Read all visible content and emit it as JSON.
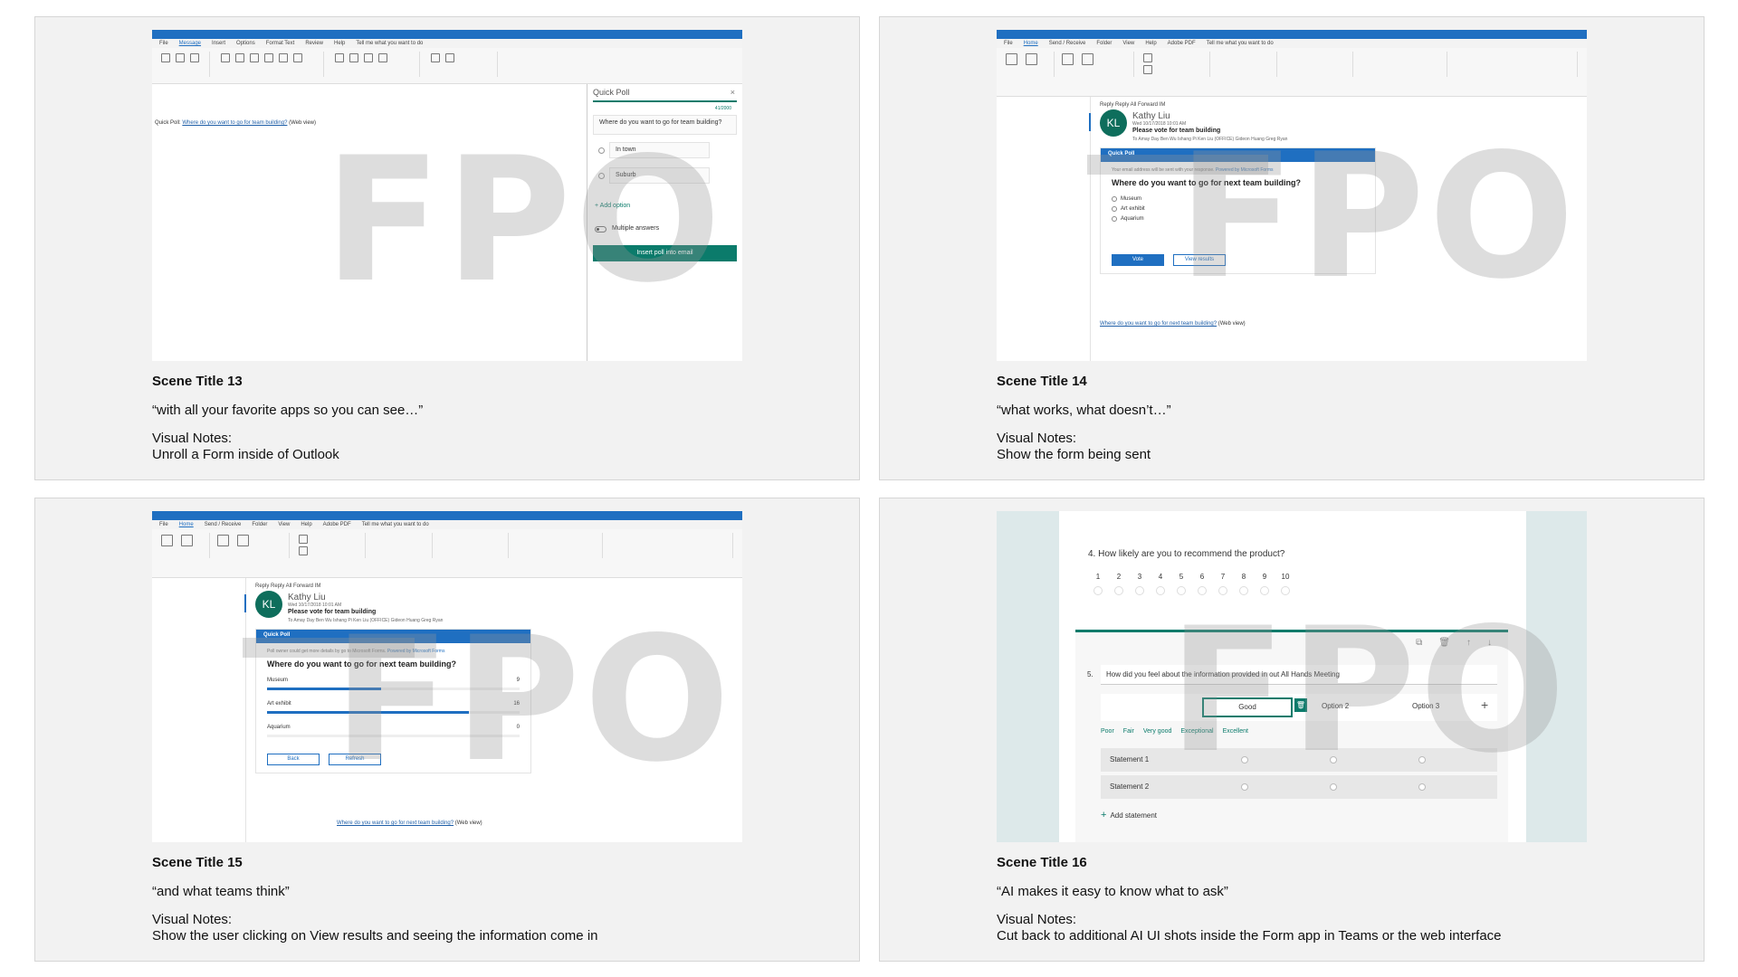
{
  "scenes": [
    {
      "title": "Scene Title 13",
      "quote": "“with all your favorite apps so you can see…”",
      "notes_label": "Visual Notes:",
      "notes": "Unroll a Form inside of Outlook",
      "mock": {
        "watermark": "FPO",
        "ribbon_tabs": [
          "File",
          "Message",
          "Insert",
          "Options",
          "Format Text",
          "Review",
          "Help",
          "Tell me what you want to do"
        ],
        "compose_link_prefix": "Quick Poll:",
        "compose_link": "Where do you want to go for team building?",
        "compose_link_suffix": "(Web view)",
        "pane_title": "Quick Poll",
        "pane_close": "×",
        "pane_count": "41/2000",
        "question": "Where do you want to go for team building?",
        "options": [
          "In town",
          "Suburb"
        ],
        "add_option": "+ Add option",
        "multiple_answers": "Multiple answers",
        "insert_button": "Insert poll into email"
      }
    },
    {
      "title": "Scene Title 14",
      "quote": "“what works, what doesn’t…”",
      "notes_label": "Visual Notes:",
      "notes": "Show the form being sent",
      "mock": {
        "watermark": "FPO",
        "ribbon_tabs": [
          "File",
          "Home",
          "Send / Receive",
          "Folder",
          "View",
          "Help",
          "Adobe PDF",
          "Tell me what you want to do"
        ],
        "actions": "Reply   Reply All   Forward   IM",
        "avatar": "KL",
        "sender": "Kathy Liu",
        "date": "Wed 10/17/2018 10:01 AM",
        "subject": "Please vote for team building",
        "recipients": "To  Amay Day  Ben Wu  Ishang Pi  Ken Liu (OFFICE)  Gideon Huang  Greg Ryan",
        "band": "Quick Poll",
        "note": "Your email address will be sent with your response.",
        "powered": "Powered by Microsoft Forms",
        "question": "Where do you want to go for next team building?",
        "options": [
          "Museum",
          "Art exhibit",
          "Aquarium"
        ],
        "vote_button": "Vote",
        "results_button": "View results",
        "footer_link": "Where do you want to go for next team building?",
        "footer_suffix": "(Web view)"
      }
    },
    {
      "title": "Scene Title 15",
      "quote": "“and what teams think”",
      "notes_label": "Visual Notes:",
      "notes": "Show the user clicking on View results and seeing the information come in",
      "mock": {
        "watermark": "FPO",
        "ribbon_tabs": [
          "File",
          "Home",
          "Send / Receive",
          "Folder",
          "View",
          "Help",
          "Adobe PDF",
          "Tell me what you want to do"
        ],
        "actions": "Reply   Reply All   Forward   IM",
        "avatar": "KL",
        "sender": "Kathy Liu",
        "date": "Wed 10/17/2018 10:01 AM",
        "subject": "Please vote for team building",
        "recipients": "To  Amay Day  Ben Wu  Ishang Pi  Ken Liu (OFFICE)  Gideon Huang  Greg Ryan",
        "band": "Quick Poll",
        "note": "Poll owner could get more details by go to Microsoft Forms.",
        "powered": "Powered by Microsoft Forms",
        "question": "Where do you want to go for next team building?",
        "results": [
          {
            "label": "Museum",
            "count": 9
          },
          {
            "label": "Art exhibit",
            "count": 16
          },
          {
            "label": "Aquarium",
            "count": 0
          }
        ],
        "result_max": 20,
        "back_button": "Back",
        "refresh_button": "Refresh",
        "footer_link": "Where do you want to go for next team building?",
        "footer_suffix": "(Web view)"
      }
    },
    {
      "title": "Scene Title 16",
      "quote": "“AI makes it easy to know what to ask”",
      "notes_label": "Visual Notes:",
      "notes": "Cut back to additional AI UI shots inside the Form app in Teams or the web interface",
      "mock": {
        "watermark": "FPO",
        "q4": "4. How likely are you to recommend the product?",
        "scale": [
          "1",
          "2",
          "3",
          "4",
          "5",
          "6",
          "7",
          "8",
          "9",
          "10"
        ],
        "q5_num": "5.",
        "q5": "How did you feel about the information provided in out All Hands Meeting",
        "option_good": "Good",
        "option2": "Option 2",
        "option3": "Option 3",
        "add_icon": "+",
        "suggestions": [
          "Poor",
          "Fair",
          "Very good",
          "Exceptional",
          "Excellent"
        ],
        "statements": [
          "Statement 1",
          "Statement 2"
        ],
        "add_statement": "Add statement",
        "tool_icons": [
          "copy-icon",
          "trash-icon",
          "arrow-up-icon",
          "arrow-down-icon"
        ]
      }
    }
  ]
}
